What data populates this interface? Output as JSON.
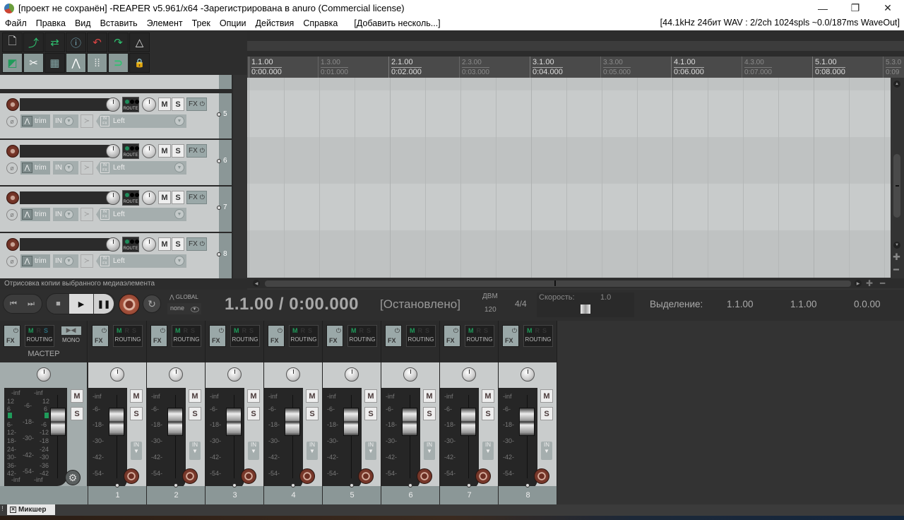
{
  "window": {
    "title": "[проект не сохранён] -REAPER v5.961/x64 -Зарегистрирована в anuro (Commercial license)",
    "minimize_icon": "minimize-icon",
    "maximize_icon": "restore-icon",
    "close_icon": "close-icon"
  },
  "menu": {
    "items": [
      "Файл",
      "Правка",
      "Вид",
      "Вставить",
      "Элемент",
      "Трек",
      "Опции",
      "Действия",
      "Справка"
    ],
    "extra": "[Добавить несколь...]",
    "audio_status": "[44.1kHz 24бит WAV : 2/2ch 1024spls ~0.0/187ms WaveOut]"
  },
  "toolbar": {
    "row1": [
      {
        "icon": "new-project-icon",
        "glyph": "🗋"
      },
      {
        "icon": "open-project-icon",
        "glyph": "⤴"
      },
      {
        "icon": "save-project-icon",
        "glyph": "⇄"
      },
      {
        "icon": "project-settings-icon",
        "glyph": "ⓘ"
      },
      {
        "icon": "undo-icon",
        "glyph": "↶"
      },
      {
        "icon": "redo-icon",
        "glyph": "↷"
      },
      {
        "icon": "metronome-icon",
        "glyph": "△"
      }
    ],
    "row2": [
      {
        "icon": "auto-crossfade-icon",
        "glyph": "◩",
        "on": true
      },
      {
        "icon": "ripple-edit-icon",
        "glyph": "✂",
        "on": true
      },
      {
        "icon": "grouping-icon",
        "glyph": "▦",
        "on": false
      },
      {
        "icon": "envelope-move-icon",
        "glyph": "⋀",
        "on": true
      },
      {
        "icon": "grid-icon",
        "glyph": "⁞⁞",
        "on": true
      },
      {
        "icon": "snap-icon",
        "glyph": "⊃",
        "on": true
      },
      {
        "icon": "lock-icon",
        "glyph": "🔒",
        "on": false
      }
    ]
  },
  "ruler": {
    "marks": [
      {
        "bar": "1.1.00",
        "time": "0:00.000",
        "major": true
      },
      {
        "bar": "1.3.00",
        "time": "0:01.000",
        "major": false
      },
      {
        "bar": "2.1.00",
        "time": "0:02.000",
        "major": true
      },
      {
        "bar": "2.3.00",
        "time": "0:03.000",
        "major": false
      },
      {
        "bar": "3.1.00",
        "time": "0:04.000",
        "major": true
      },
      {
        "bar": "3.3.00",
        "time": "0:05.000",
        "major": false
      },
      {
        "bar": "4.1.00",
        "time": "0:06.000",
        "major": true
      },
      {
        "bar": "4.3.00",
        "time": "0:07.000",
        "major": false
      },
      {
        "bar": "5.1.00",
        "time": "0:08.000",
        "major": true
      },
      {
        "bar": "5.3.0",
        "time": "0:09",
        "major": false
      }
    ]
  },
  "tracks": [
    {
      "number": "5",
      "trim_label": "trim",
      "in_label": "IN",
      "input": "Left",
      "route_label": "ROUTE",
      "mute": "M",
      "solo": "S",
      "fx": "FX"
    },
    {
      "number": "6",
      "trim_label": "trim",
      "in_label": "IN",
      "input": "Left",
      "route_label": "ROUTE",
      "mute": "M",
      "solo": "S",
      "fx": "FX"
    },
    {
      "number": "7",
      "trim_label": "trim",
      "in_label": "IN",
      "input": "Left",
      "route_label": "ROUTE",
      "mute": "M",
      "solo": "S",
      "fx": "FX"
    },
    {
      "number": "8",
      "trim_label": "trim",
      "in_label": "IN",
      "input": "Left",
      "route_label": "ROUTE",
      "mute": "M",
      "solo": "S",
      "fx": "FX"
    }
  ],
  "status": {
    "text": "Отрисовка копии выбранного медиаэлемента"
  },
  "transport": {
    "position": "1.1.00 / 0:00.000",
    "state": "[Остановлено]",
    "bpm_label": "ДВМ",
    "bpm": "120",
    "time_signature": "4/4",
    "rate_label": "Скорость:",
    "rate": "1.0",
    "selection_label": "Выделение:",
    "selection_start": "1.1.00",
    "selection_end": "1.1.00",
    "selection_length": "0.0.00",
    "global_label": "GLOBAL",
    "global_mode": "none"
  },
  "mixer": {
    "master": {
      "label": "МАСТЕР",
      "fx": "FX",
      "routing": "ROUTING",
      "mono": "MONO",
      "mute": "M",
      "solo": "S",
      "scale_left": [
        "12",
        "6",
        "6-",
        "12-",
        "18-",
        "24-",
        "30-",
        "36-",
        "42-"
      ],
      "scale_mid": [
        "-6-",
        "-18-",
        "-30-",
        "-42-",
        "-54-"
      ],
      "scale_right": [
        "12",
        "6",
        "-6",
        "-12",
        "-18",
        "-24",
        "-30",
        "-36",
        "-42"
      ],
      "peak_left": "-inf",
      "peak_right": "-inf",
      "foot_left": "-inf",
      "foot_right": "-inf"
    },
    "strip_scale": [
      "-inf",
      "-6-",
      "-18-",
      "-30-",
      "-42-",
      "-54-"
    ],
    "strips": [
      {
        "number": "1",
        "fx": "FX",
        "routing": "ROUTING",
        "mute": "M",
        "solo": "S",
        "in": "IN"
      },
      {
        "number": "2",
        "fx": "FX",
        "routing": "ROUTING",
        "mute": "M",
        "solo": "S",
        "in": "IN"
      },
      {
        "number": "3",
        "fx": "FX",
        "routing": "ROUTING",
        "mute": "M",
        "solo": "S",
        "in": "IN"
      },
      {
        "number": "4",
        "fx": "FX",
        "routing": "ROUTING",
        "mute": "M",
        "solo": "S",
        "in": "IN"
      },
      {
        "number": "5",
        "fx": "FX",
        "routing": "ROUTING",
        "mute": "M",
        "solo": "S",
        "in": "IN"
      },
      {
        "number": "6",
        "fx": "FX",
        "routing": "ROUTING",
        "mute": "M",
        "solo": "S",
        "in": "IN"
      },
      {
        "number": "7",
        "fx": "FX",
        "routing": "ROUTING",
        "mute": "M",
        "solo": "S",
        "in": "IN"
      },
      {
        "number": "8",
        "fx": "FX",
        "routing": "ROUTING",
        "mute": "M",
        "solo": "S",
        "in": "IN"
      }
    ]
  },
  "docker": {
    "tab_label": "Микшер",
    "alert": "!"
  }
}
